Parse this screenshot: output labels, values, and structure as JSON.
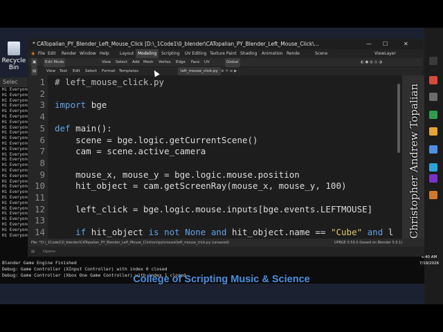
{
  "desktop": {
    "recycle_bin_label": "Recycle Bin"
  },
  "console": {
    "title": "Selec",
    "repeat_line": "Hi Everyone",
    "repeat_count": 28,
    "bottom_lines": [
      "Blender Game Engine Finished",
      "Debug: Game Controller (XInput Controller) with index 0 closed",
      "Debug: Game Controller (Xbox One Game Controller) with index 1 closed"
    ]
  },
  "blender": {
    "window_title": "* CATopalian_PY_Blender_Left_Mouse_Click [D:\\_1Code1\\0_blender\\CATopalian_PY_Blender_Left_Mouse_Click\\...",
    "menus": [
      "File",
      "Edit",
      "Render",
      "Window",
      "Help"
    ],
    "workspaces": [
      "Layout",
      "Modeling",
      "Scripting",
      "UV Editing",
      "Texture Paint",
      "Shading",
      "Animation",
      "Rende"
    ],
    "active_workspace": "Modeling",
    "scene_label": "Scene",
    "view_layer_label": "ViewLayer",
    "viewport_header": {
      "mode": "Edit Mode",
      "items": [
        "View",
        "Select",
        "Add",
        "Mesh",
        "Vertex",
        "Edge",
        "Face",
        "UV"
      ],
      "orientation": "Global"
    },
    "text_header": {
      "items": [
        "View",
        "Text",
        "Edit",
        "Select",
        "Format",
        "Templates"
      ],
      "filename": "left_mouse_click.py"
    },
    "code_lines": [
      "# left_mouse_click.py",
      "",
      "import bge",
      "",
      "def main():",
      "    scene = bge.logic.getCurrentScene()",
      "    cam = scene.active_camera",
      "",
      "    mouse_x, mouse_y = bge.logic.mouse.position",
      "    hit_object = cam.getScreenRay(mouse_x, mouse_y, 100)",
      "",
      "    left_click = bge.logic.mouse.inputs[bge.events.LEFTMOUSE]",
      "",
      "    if hit_object is not None and hit_object.name == \"Cube\" and l"
    ],
    "status_left": "File: *D:\\_1Code1\\0_blender\\CATopalian_PY_Blender_Left_Mouse_Click\\src\\py\\mouse\\left_mouse_click.py (unsaved)",
    "status_right": "UPBGE 0.50.0 (based on Blender 5.0.1)",
    "console_strip_label": "Opone"
  },
  "taskbar": {
    "time": "4:40 AM",
    "date": "7/19/2026"
  },
  "watermark": "Christopher Andrew Topalian",
  "caption": "College of Scripting Music & Science"
}
